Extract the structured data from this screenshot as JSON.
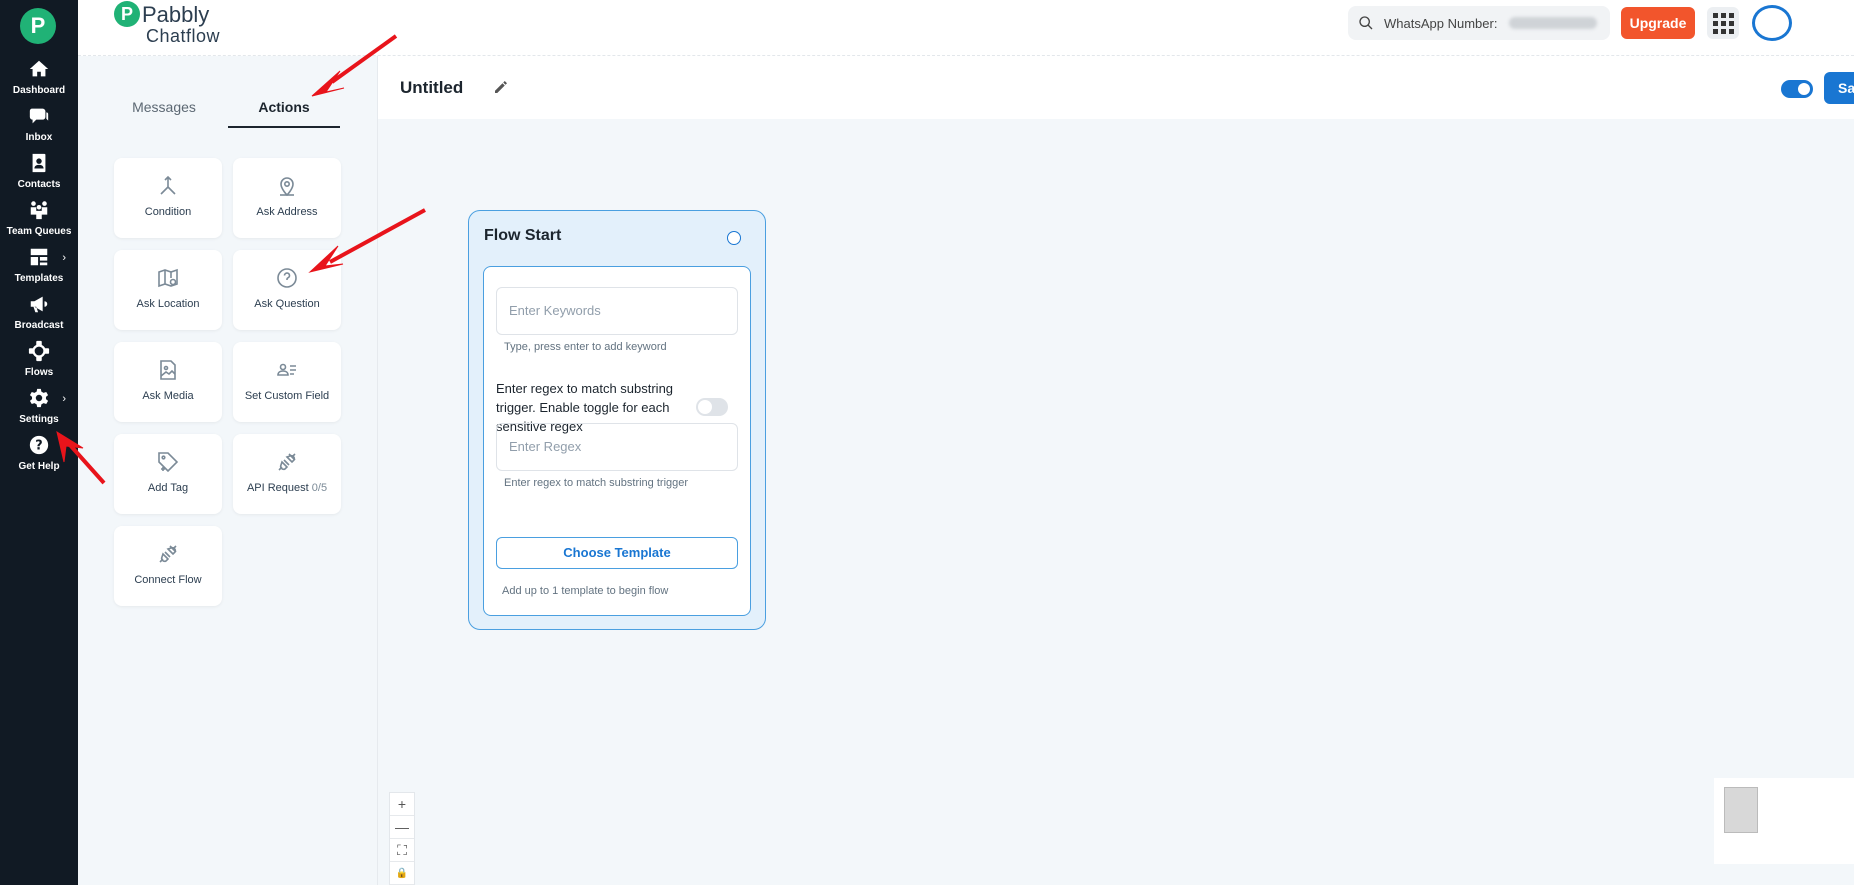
{
  "app": {
    "brand_letter": "P",
    "brand_name": "Pabbly",
    "brand_sub": "Chatflow"
  },
  "nav": {
    "items": [
      {
        "label": "Dashboard",
        "icon": "home-icon"
      },
      {
        "label": "Inbox",
        "icon": "chat-icon"
      },
      {
        "label": "Contacts",
        "icon": "contacts-icon"
      },
      {
        "label": "Team Queues",
        "icon": "team-icon"
      },
      {
        "label": "Templates",
        "icon": "templates-icon"
      },
      {
        "label": "Broadcast",
        "icon": "megaphone-icon"
      },
      {
        "label": "Flows",
        "icon": "flows-icon"
      },
      {
        "label": "Settings",
        "icon": "gear-icon"
      },
      {
        "label": "Get Help",
        "icon": "help-icon"
      }
    ]
  },
  "header": {
    "search_label": "WhatsApp Number:",
    "upgrade_label": "Upgrade"
  },
  "panel": {
    "tabs": [
      {
        "label": "Messages",
        "active": false
      },
      {
        "label": "Actions",
        "active": true
      }
    ],
    "cards": [
      {
        "label": "Condition",
        "icon": "condition-icon"
      },
      {
        "label": "Ask Address",
        "icon": "location-pin-icon"
      },
      {
        "label": "Ask Location",
        "icon": "map-icon"
      },
      {
        "label": "Ask Question",
        "icon": "question-icon"
      },
      {
        "label": "Ask Media",
        "icon": "image-icon"
      },
      {
        "label": "Set Custom Field",
        "icon": "custom-field-icon"
      },
      {
        "label": "Add Tag",
        "icon": "tag-icon"
      },
      {
        "label": "API Request",
        "count": "0/5",
        "icon": "plug-icon"
      },
      {
        "label": "Connect Flow",
        "icon": "plug-icon"
      }
    ]
  },
  "canvas": {
    "title": "Untitled",
    "save_label": "Sa",
    "node": {
      "title": "Flow Start",
      "keywords_placeholder": "Enter Keywords",
      "keywords_helper": "Type, press enter to add keyword",
      "regex_text": "Enter regex to match substring trigger. Enable toggle for each sensitive regex",
      "regex_placeholder": "Enter Regex",
      "regex_helper": "Enter regex to match substring trigger",
      "choose_label": "Choose Template",
      "choose_helper": "Add up to 1 template to begin flow"
    },
    "zoom": [
      "+",
      "—",
      "⛶",
      "🔒"
    ]
  },
  "colors": {
    "nav_bg": "#111a24",
    "brand_green": "#20b276",
    "accent_blue": "#1976d2",
    "upgrade_orange": "#f2552c",
    "annotation_red": "#e8141b"
  }
}
